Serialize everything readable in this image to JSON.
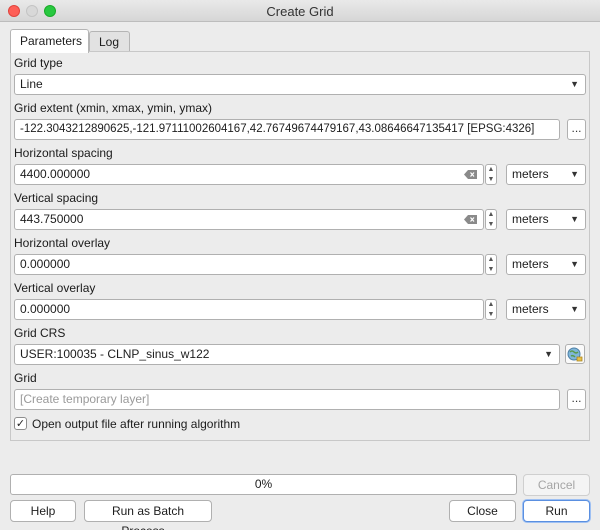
{
  "window": {
    "title": "Create Grid"
  },
  "tabs": [
    {
      "label": "Parameters",
      "active": true
    },
    {
      "label": "Log",
      "active": false
    }
  ],
  "params": {
    "grid_type": {
      "label": "Grid type",
      "value": "Line"
    },
    "grid_extent": {
      "label": "Grid extent (xmin, xmax, ymin, ymax)",
      "value": "-122.3043212890625,-121.97111002604167,42.76749674479167,43.08646647135417 [EPSG:4326]"
    },
    "horizontal_spacing": {
      "label": "Horizontal spacing",
      "value": "4400.000000",
      "unit": "meters"
    },
    "vertical_spacing": {
      "label": "Vertical spacing",
      "value": "443.750000",
      "unit": "meters"
    },
    "horizontal_overlay": {
      "label": "Horizontal overlay",
      "value": "0.000000",
      "unit": "meters"
    },
    "vertical_overlay": {
      "label": "Vertical overlay",
      "value": "0.000000",
      "unit": "meters"
    },
    "grid_crs": {
      "label": "Grid CRS",
      "value": "USER:100035 - CLNP_sinus_w122"
    },
    "grid_output": {
      "label": "Grid",
      "placeholder": "[Create temporary layer]",
      "value": ""
    },
    "open_output": {
      "label": "Open output file after running algorithm",
      "checked": true,
      "mark": "✓"
    }
  },
  "browse_label": "...",
  "progress": {
    "percent": 0,
    "text": "0%"
  },
  "buttons": {
    "cancel": "Cancel",
    "help": "Help",
    "batch": "Run as Batch Process...",
    "close": "Close",
    "run": "Run"
  },
  "colors": {
    "traffic_close": "#fe5f57",
    "traffic_max": "#28c840",
    "progress_fill": "#4f8ee8",
    "run_focus": "#5a8fe0"
  }
}
